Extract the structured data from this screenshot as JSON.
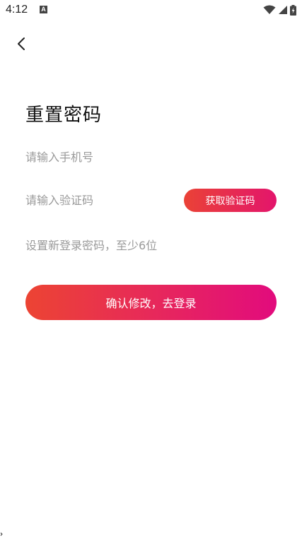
{
  "status_bar": {
    "time": "4:12",
    "notification_badge": "A",
    "icons": [
      "wifi-icon",
      "signal-icon",
      "battery-charging-icon"
    ]
  },
  "header": {
    "back_icon": "chevron-left-icon"
  },
  "form": {
    "title": "重置密码",
    "phone_placeholder": "请输入手机号",
    "code_placeholder": "请输入验证码",
    "get_code_label": "获取验证码",
    "password_placeholder": "设置新登录密码，至少6位",
    "confirm_label": "确认修改，去登录"
  },
  "colors": {
    "accent_start": "#ea4236",
    "accent_end": "#e20b7d",
    "placeholder": "#9a9a9a"
  }
}
